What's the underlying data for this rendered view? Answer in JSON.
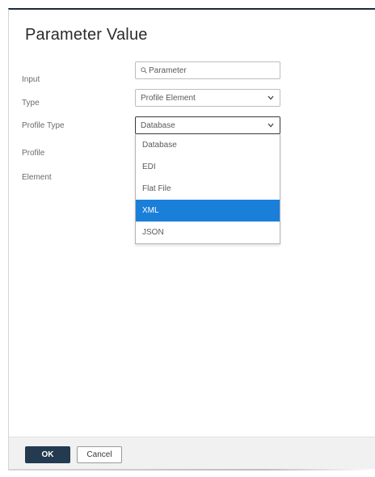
{
  "dialog": {
    "title": "Parameter Value"
  },
  "form": {
    "input_label": "Input",
    "input_value": "Parameter",
    "type_label": "Type",
    "type_value": "Profile Element",
    "profile_type_label": "Profile Type",
    "profile_type_value": "Database",
    "profile_label": "Profile",
    "element_label": "Element"
  },
  "dropdown": {
    "options": [
      {
        "label": "Database",
        "selected": false
      },
      {
        "label": "EDI",
        "selected": false
      },
      {
        "label": "Flat File",
        "selected": false
      },
      {
        "label": "XML",
        "selected": true
      },
      {
        "label": "JSON",
        "selected": false
      }
    ]
  },
  "footer": {
    "ok_label": "OK",
    "cancel_label": "Cancel"
  },
  "colors": {
    "primary_button": "#233a50",
    "selected_option": "#1a7fd9",
    "dialog_top_border": "#1a2b3c"
  },
  "icons": {
    "search": "search-icon",
    "chevron": "chevron-down-icon"
  }
}
